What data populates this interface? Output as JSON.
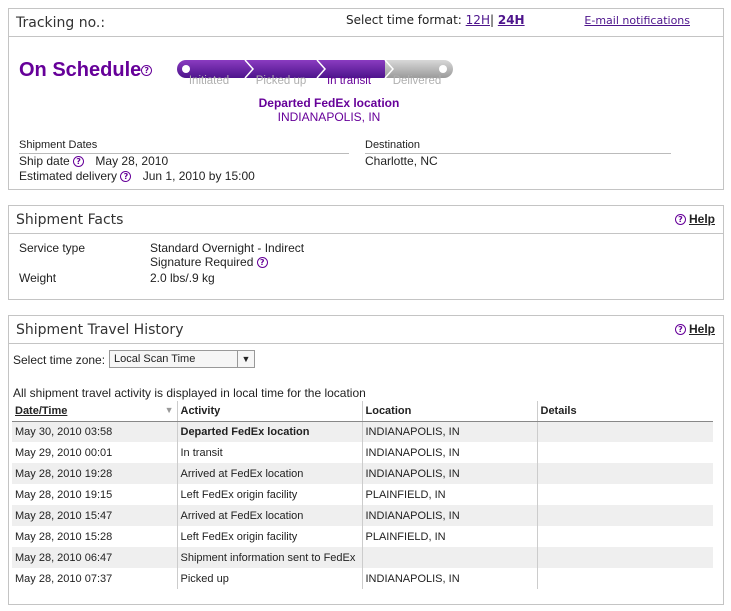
{
  "tracking": {
    "title": "Tracking no.:",
    "time_format_label": "Select time format:",
    "format_12h": "12H",
    "format_sep": "|",
    "format_24h": "24H",
    "email_link": "E-mail notifications",
    "status": "On Schedule",
    "progress": {
      "steps": [
        "Initiated",
        "Picked up",
        "In transit",
        "Delivered"
      ],
      "active_index": 2
    },
    "location_title": "Departed FedEx location",
    "location_city": "INDIANAPOLIS, IN",
    "dates_header": "Shipment Dates",
    "destination_header": "Destination",
    "ship_date_label": "Ship date",
    "ship_date_value": "May 28, 2010",
    "est_delivery_label": "Estimated delivery",
    "est_delivery_value": "Jun 1, 2010 by 15:00",
    "destination_value": "Charlotte, NC"
  },
  "facts": {
    "title": "Shipment Facts",
    "help": "Help",
    "service_label": "Service type",
    "service_value": "Standard Overnight - Indirect",
    "signature": "Signature Required",
    "weight_label": "Weight",
    "weight_value": "2.0 lbs/.9 kg"
  },
  "history": {
    "title": "Shipment Travel History",
    "help": "Help",
    "tz_label": "Select time zone:",
    "tz_value": "Local Scan Time",
    "note": "All shipment travel activity is displayed in local time for the location",
    "columns": [
      "Date/Time",
      "Activity",
      "Location",
      "Details"
    ],
    "rows": [
      {
        "date": "May 30, 2010 03:58",
        "activity": "Departed FedEx location",
        "location": "INDIANAPOLIS, IN",
        "details": "",
        "bold": true
      },
      {
        "date": "May 29, 2010 00:01",
        "activity": "In transit",
        "location": "INDIANAPOLIS, IN",
        "details": ""
      },
      {
        "date": "May 28, 2010 19:28",
        "activity": "Arrived at FedEx location",
        "location": "INDIANAPOLIS, IN",
        "details": ""
      },
      {
        "date": "May 28, 2010 19:15",
        "activity": "Left FedEx origin facility",
        "location": "PLAINFIELD, IN",
        "details": ""
      },
      {
        "date": "May 28, 2010 15:47",
        "activity": "Arrived at FedEx location",
        "location": "INDIANAPOLIS, IN",
        "details": ""
      },
      {
        "date": "May 28, 2010 15:28",
        "activity": "Left FedEx origin facility",
        "location": "PLAINFIELD, IN",
        "details": ""
      },
      {
        "date": "May 28, 2010 06:47",
        "activity": "Shipment information sent to FedEx",
        "location": "",
        "details": ""
      },
      {
        "date": "May 28, 2010 07:37",
        "activity": "Picked up",
        "location": "INDIANAPOLIS, IN",
        "details": ""
      }
    ]
  },
  "colors": {
    "brand_purple": "#660099",
    "progress_purple": "#4d148c",
    "progress_grey": "#9a9a9a"
  }
}
